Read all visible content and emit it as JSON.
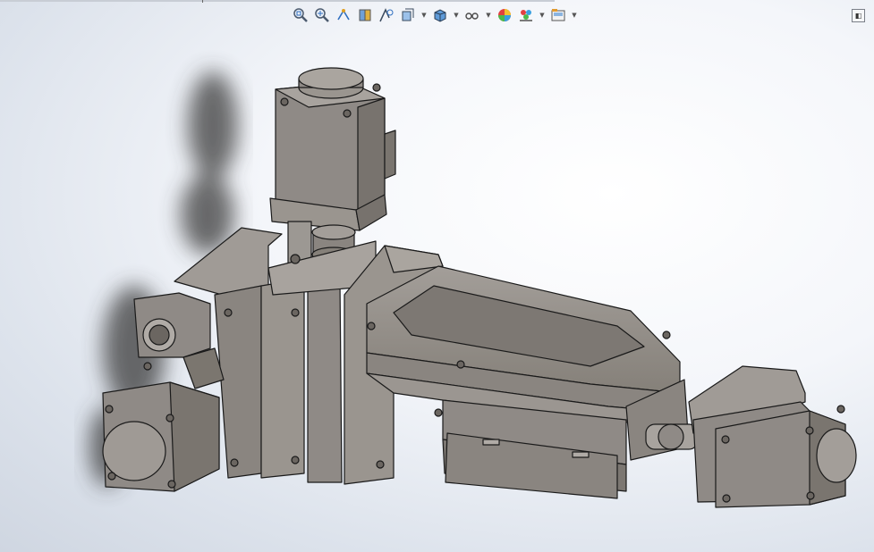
{
  "toolbar": {
    "items": [
      {
        "name": "zoom-to-fit-icon",
        "has_dropdown": false
      },
      {
        "name": "zoom-to-area-icon",
        "has_dropdown": false
      },
      {
        "name": "previous-view-icon",
        "has_dropdown": false
      },
      {
        "name": "section-view-icon",
        "has_dropdown": false
      },
      {
        "name": "dynamic-annotation-view-icon",
        "has_dropdown": false
      },
      {
        "name": "view-orientation-icon",
        "has_dropdown": true
      },
      {
        "name": "display-style-icon",
        "has_dropdown": true
      },
      {
        "name": "hide-show-items-icon",
        "has_dropdown": true
      },
      {
        "name": "edit-appearance-icon",
        "has_dropdown": false
      },
      {
        "name": "apply-scene-icon",
        "has_dropdown": true
      },
      {
        "name": "view-settings-icon",
        "has_dropdown": true
      }
    ],
    "expand_icon": "expand-panel-icon"
  },
  "model": {
    "description": "gray-cad-assembly",
    "part_color": "#8f8a86",
    "edge_color": "#1a1a1a",
    "shadow_color": "#3a3a3a"
  }
}
